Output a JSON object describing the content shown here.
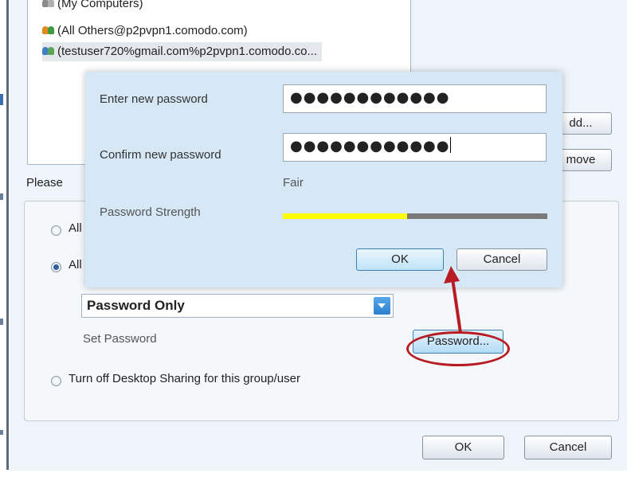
{
  "user_list": {
    "items": [
      {
        "label": "(My Computers)"
      },
      {
        "label": "(All Others@p2pvpn1.comodo.com)"
      },
      {
        "label": "(testuser720%gmail.com%p2pvpn1.comodo.co..."
      }
    ]
  },
  "side_buttons": {
    "add_label": "dd...",
    "remove_label": "move"
  },
  "section_prompt": "Please",
  "options": {
    "radio1_label": "All",
    "radio2_label": "All",
    "auth_select_value": "Password Only",
    "set_password_label": "Set Password",
    "password_button_label": "Password...",
    "radio3_label": "Turn off Desktop Sharing for this group/user"
  },
  "footer": {
    "ok_label": "OK",
    "cancel_label": "Cancel"
  },
  "password_dialog": {
    "new_password_label": "Enter new password",
    "new_password_value": "●●●●●●●●●●●●",
    "confirm_password_label": "Confirm new password",
    "confirm_password_value": "●●●●●●●●●●●●",
    "strength_text": "Fair",
    "strength_label": "Password Strength",
    "strength_level": 0.47,
    "ok_label": "OK",
    "cancel_label": "Cancel"
  },
  "colors": {
    "strength_fill": "#ffff00",
    "callout": "#b81c22",
    "select_arrow": "#2b7fce"
  },
  "icons": {
    "user_group": "user-group-icon",
    "dropdown": "chevron-down-icon"
  }
}
